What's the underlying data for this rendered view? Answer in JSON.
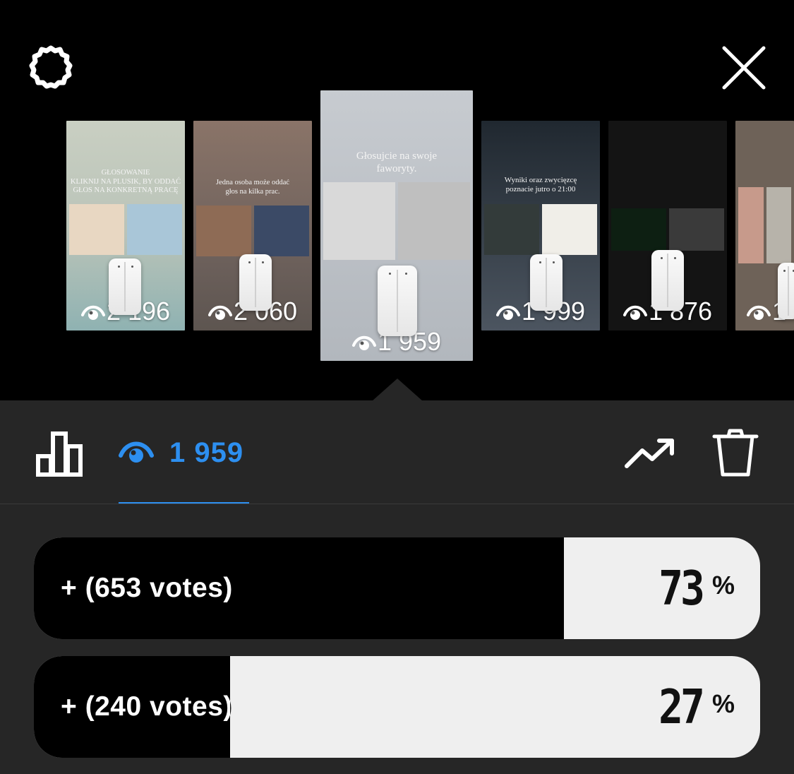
{
  "header": {
    "settings_icon": "gear-icon",
    "close_icon": "close-icon"
  },
  "stories": [
    {
      "caption_lines": [
        "GŁOSOWANIE",
        "KLIKNIJ NA PLUSIK, BY ODDAĆ",
        "GŁOS NA KONKRETNĄ PRACĘ"
      ],
      "views": "2 196",
      "bg": "#93a79b"
    },
    {
      "caption_lines": [
        "Jedna osoba może oddać",
        "głos na kilka prac."
      ],
      "views": "2 060",
      "bg": "#7a6b64"
    },
    {
      "caption_lines": [
        "Głosujcie na swoje",
        "faworyty."
      ],
      "views": "1 959",
      "bg": "#c5c9cd",
      "selected": true
    },
    {
      "caption_lines": [
        "Wyniki oraz zwycięzcę",
        "poznacie jutro o 21:00"
      ],
      "views": "1 999",
      "bg": "#2a3038"
    },
    {
      "caption_lines": [],
      "views": "1 876",
      "bg": "#141414"
    },
    {
      "caption_lines": [],
      "views": "1",
      "bg": "#6e6258"
    }
  ],
  "tabs": {
    "chart_icon": "bar-chart-icon",
    "views_icon": "eye-icon",
    "views_count": "1 959",
    "trend_icon": "trending-up-icon",
    "trash_icon": "trash-icon",
    "accent": "#2d8ff0"
  },
  "poll": {
    "options": [
      {
        "label": "+ (653 votes)",
        "percent_text": "73",
        "percent_sign": "%",
        "fraction": 0.73
      },
      {
        "label": "+ (240 votes)",
        "percent_text": "27",
        "percent_sign": "%",
        "fraction": 0.27
      }
    ]
  }
}
